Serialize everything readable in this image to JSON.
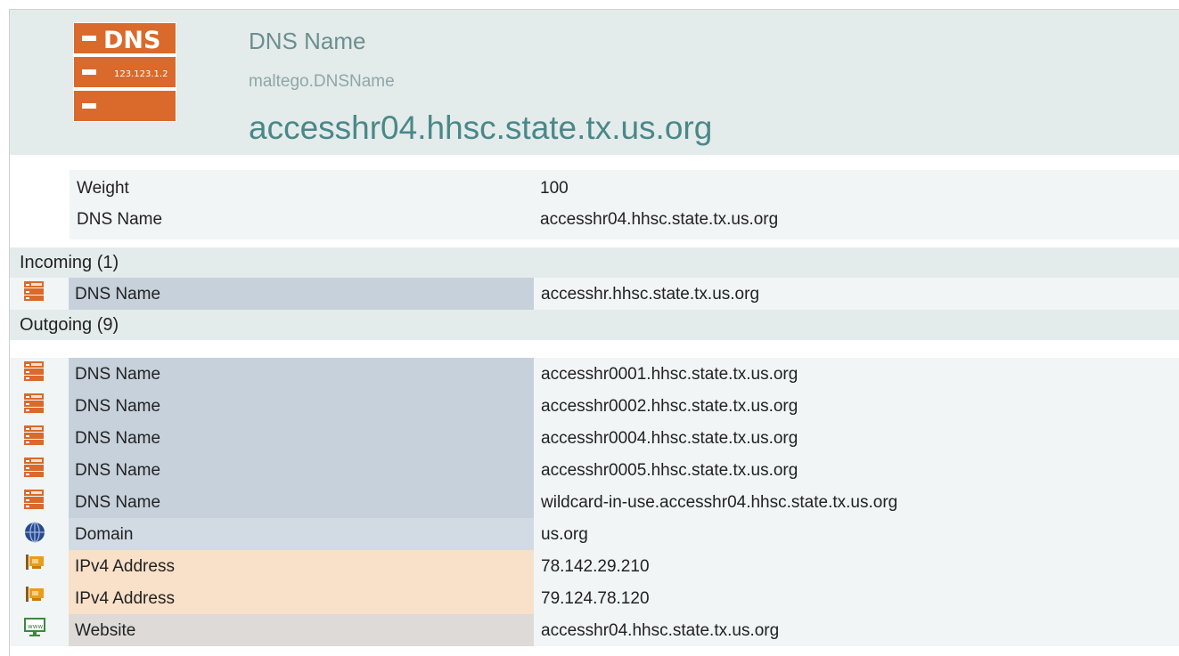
{
  "header": {
    "icon": "dns-name-icon",
    "icon_text_big": "DNS",
    "icon_text_small": "123.123.1.2",
    "entity_type": "DNS Name",
    "entity_class": "maltego.DNSName",
    "entity_value": "accesshr04.hhsc.state.tx.us.org"
  },
  "properties": [
    {
      "key": "Weight",
      "value": "100"
    },
    {
      "key": "DNS Name",
      "value": "accesshr04.hhsc.state.tx.us.org"
    }
  ],
  "incoming": {
    "label": "Incoming (1)",
    "rows": [
      {
        "icon": "dns-name-icon",
        "type": "DNS Name",
        "value": "accesshr.hhsc.state.tx.us.org"
      }
    ]
  },
  "outgoing": {
    "label": "Outgoing (9)",
    "rows": [
      {
        "icon": "dns-name-icon",
        "type": "DNS Name",
        "value": "accesshr0001.hhsc.state.tx.us.org"
      },
      {
        "icon": "dns-name-icon",
        "type": "DNS Name",
        "value": "accesshr0002.hhsc.state.tx.us.org"
      },
      {
        "icon": "dns-name-icon",
        "type": "DNS Name",
        "value": "accesshr0004.hhsc.state.tx.us.org"
      },
      {
        "icon": "dns-name-icon",
        "type": "DNS Name",
        "value": "accesshr0005.hhsc.state.tx.us.org"
      },
      {
        "icon": "dns-name-icon",
        "type": "DNS Name",
        "value": "wildcard-in-use.accesshr04.hhsc.state.tx.us.org"
      },
      {
        "icon": "domain-globe-icon",
        "type": "Domain",
        "value": "us.org"
      },
      {
        "icon": "ipv4-network-card-icon",
        "type": "IPv4 Address",
        "value": "78.142.29.210"
      },
      {
        "icon": "ipv4-network-card-icon",
        "type": "IPv4 Address",
        "value": "79.124.78.120"
      },
      {
        "icon": "website-www-icon",
        "type": "Website",
        "value": "accesshr04.hhsc.state.tx.us.org"
      }
    ]
  },
  "colors": {
    "header_bg": "#e4ebeb",
    "row_bg": "#f1f5f5",
    "dns_cell": "#c7d1db",
    "domain_cell": "#d2dae4",
    "ipv4_cell": "#f8e0c9",
    "website_cell": "#dedad8",
    "dns_icon_orange": "#d96a2b",
    "entity_value_teal": "#4a8888"
  }
}
